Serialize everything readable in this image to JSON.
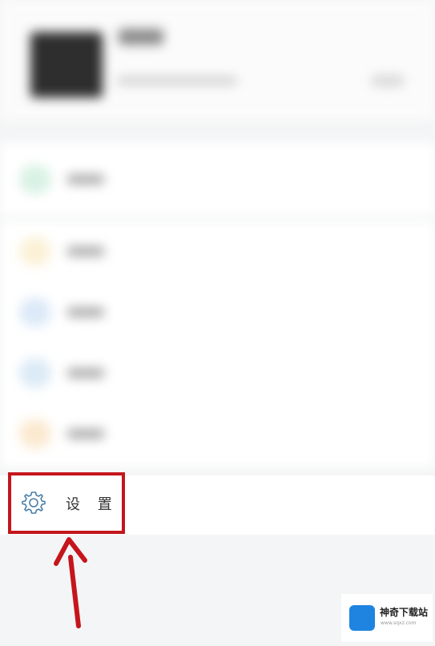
{
  "settings_item": {
    "label": "设 置"
  },
  "watermark": {
    "title": "神奇下载站",
    "url": "www.sqxz.com"
  },
  "colors": {
    "highlight": "#c4161c",
    "watermark_blue": "#1f84e0"
  },
  "icons": {
    "settings": "gear-icon",
    "arrow": "arrow-up-icon"
  },
  "menu_dots": [
    "#d9f2e4",
    "#fbf1d6",
    "#dce9f8",
    "#dbeaf6",
    "#fbe9cf"
  ]
}
